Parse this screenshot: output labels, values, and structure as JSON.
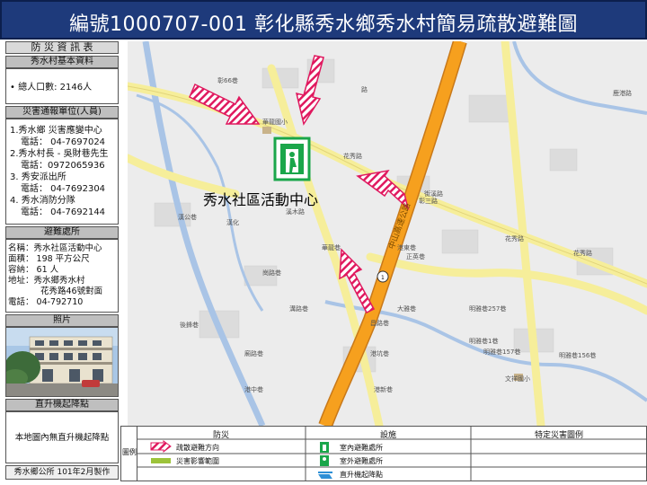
{
  "title": "編號1000707-001  彰化縣秀水鄉秀水村簡易疏散避難圖",
  "sidebar": {
    "header": "防 災 資 訊 表",
    "basic_head": "秀水村基本資料",
    "population": "• 總人口數: 2146人",
    "report_head": "災害通報單位(人員)",
    "contacts": [
      "1.秀水鄉 災害應變中心",
      "   電話： 04-7697024",
      "2.秀水村長 - 吳財巷先生",
      "   電話：0972065936",
      "3. 秀安派出所",
      "   電話： 04-7692304",
      "4. 秀水消防分隊",
      "   電話： 04-7692144"
    ],
    "shelter_head": "避難處所",
    "shelter": [
      "名稱：秀水社區活動中心",
      "面積： 198 平方公尺",
      "容納：  61    人",
      "地址：秀水鄉秀水村",
      "          花秀路46號對面",
      "電話： 04-792710"
    ],
    "photo_head": "照片",
    "heli_head": "直升機起降點",
    "heli_text": "本地圖內無直升機起降點",
    "footer": "秀水鄉公所 101年2月製作"
  },
  "map": {
    "shelter_label": "秀水社區活動中心",
    "labels": {
      "school_top": "華龍國小",
      "school_bottom": "文祥國小",
      "road_huaxiu": "花秀路",
      "road_huaxiu2": "花秀路",
      "highway": "中山高速公路",
      "road_66": "彰66巷",
      "small1": "漢公巷",
      "small2": "漢化",
      "small3": "華龍巷",
      "small4": "崗路巷",
      "small5": "正英巷",
      "small6": "港東巷",
      "small7": "街溪路",
      "small8": "港坑巷",
      "small9": "昌路巷",
      "small10": "港新巷",
      "small11": "後鋒巷",
      "small12": "明雅巷257巷",
      "small13": "明雅巷1巷",
      "small14": "明雅巷157巷",
      "small15": "明雅巷156巷",
      "small16": "廟路巷",
      "small17": "港中巷",
      "small18": "溪木路",
      "small19": "彰三路",
      "small20": "路",
      "small21": "大雅巷",
      "small22": "溝路巷",
      "small23": "花秀路",
      "small24": "鹿港路",
      "route_no": "1"
    },
    "colors": {
      "highway": "#f6a01e",
      "road": "#f6ee9a",
      "river": "#a9c4e6",
      "water": "#c6d9ef",
      "arrow": "#e0195f",
      "shelter_icon": "#1aa64a",
      "land": "#ececec"
    }
  },
  "legend": {
    "side_label": "圖例",
    "col_disaster": "防災",
    "col_facility": "設施",
    "col_special": "特定災害圖例",
    "evac_direction": "疏散避難方向",
    "disaster_area": "災害影響範圍",
    "indoor_shelter": "室內避難處所",
    "outdoor_shelter": "室外避難處所",
    "heli_point": "直升機起降點"
  }
}
